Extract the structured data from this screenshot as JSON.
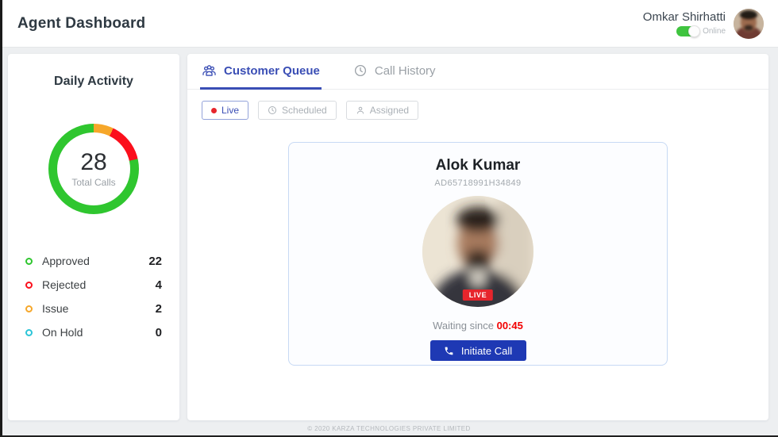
{
  "colors": {
    "accent-blue": "#3a4eb5",
    "button-blue": "#1e39b4",
    "live-red": "#e6252c",
    "timer-red": "#f20000",
    "toggle-green": "#3fc43f"
  },
  "header": {
    "title": "Agent Dashboard",
    "user": {
      "name": "Omkar Shirhatti",
      "status_label": "Online",
      "status_on": true
    }
  },
  "sidebar": {
    "title": "Daily Activity"
  },
  "chart_data": {
    "type": "pie",
    "subtype": "donut",
    "title": "Daily Activity",
    "center_value": "28",
    "center_label": "Total Calls",
    "categories": [
      "Approved",
      "Rejected",
      "Issue",
      "On Hold"
    ],
    "values": [
      22,
      4,
      2,
      0
    ],
    "colors": [
      "#2fc62f",
      "#fb0f1c",
      "#f6a72a",
      "#2cc5d8"
    ],
    "segment_order": [
      "Issue",
      "Rejected",
      "Approved",
      "On Hold"
    ],
    "legend_position": "below"
  },
  "main": {
    "tabs": [
      {
        "label": "Customer Queue",
        "icon": "group-icon",
        "active": true
      },
      {
        "label": "Call History",
        "icon": "history-icon",
        "active": false
      }
    ],
    "filters": [
      {
        "label": "Live",
        "icon": "red-dot",
        "active": true
      },
      {
        "label": "Scheduled",
        "icon": "clock-icon",
        "active": false
      },
      {
        "label": "Assigned",
        "icon": "person-icon",
        "active": false
      }
    ]
  },
  "queue_card": {
    "customer_name": "Alok Kumar",
    "customer_id": "AD65718991H34849",
    "live_badge": "LIVE",
    "waiting_label": "Waiting since",
    "waiting_time": "00:45",
    "call_button": "Initiate Call"
  },
  "footer": {
    "copyright": "© 2020 KARZA TECHNOLOGIES PRIVATE LIMITED"
  }
}
